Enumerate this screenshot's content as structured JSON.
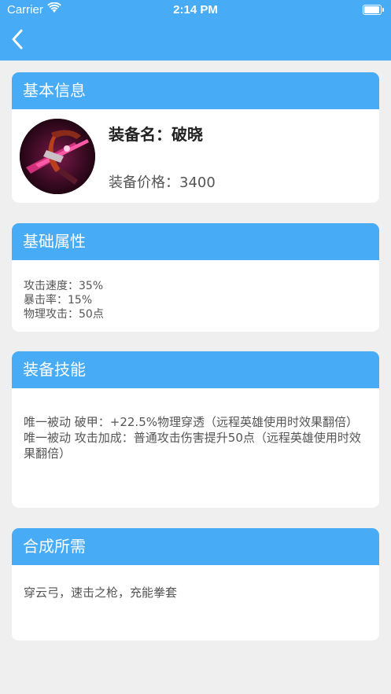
{
  "status_bar": {
    "carrier": "Carrier",
    "time": "2:14 PM"
  },
  "nav": {
    "back_icon": "chevron-left-icon"
  },
  "colors": {
    "accent": "#47abf5",
    "background": "#efefef",
    "card": "#ffffff"
  },
  "basic_info": {
    "title": "基本信息",
    "name_label": "装备名：",
    "name_value": "破晓",
    "price_label": "装备价格：",
    "price_value": "3400"
  },
  "attributes": {
    "title": "基础属性",
    "lines": [
      "攻击速度：35%",
      "暴击率：15%",
      "物理攻击：50点"
    ]
  },
  "skills": {
    "title": "装备技能",
    "lines": [
      "唯一被动 破甲：+22.5%物理穿透（远程英雄使用时效果翻倍）",
      "唯一被动 攻击加成：普通攻击伤害提升50点（远程英雄使用时效果翻倍）"
    ]
  },
  "compose": {
    "title": "合成所需",
    "text": "穿云弓，速击之枪，充能拳套"
  }
}
